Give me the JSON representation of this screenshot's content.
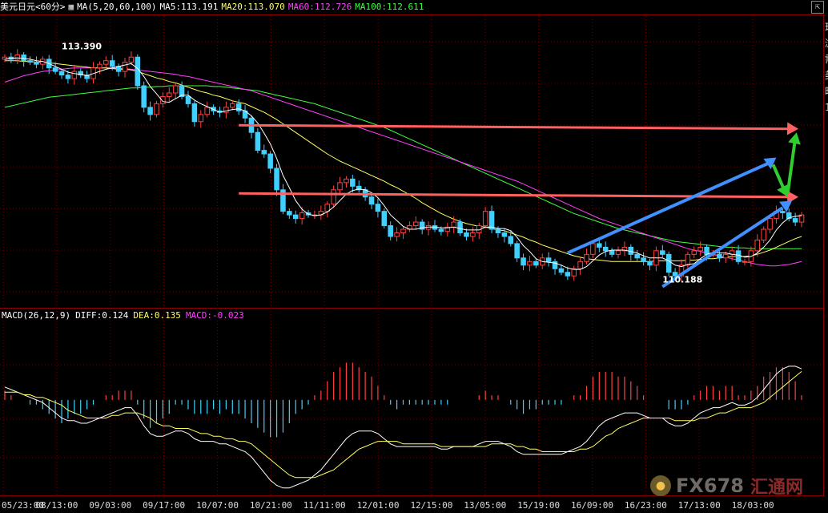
{
  "header": {
    "symbol": "美元日元<60分>",
    "ma_label": "MA(5,20,60,100)",
    "ma5": "MA5:113.191",
    "ma20": "MA20:113.070",
    "ma60": "MA60:112.726",
    "ma100": "MA100:112.611"
  },
  "macd_header": {
    "label": "MACD(26,12,9)",
    "diff": "DIFF:0.124",
    "dea": "DEA:0.135",
    "macd": "MACD:-0.023"
  },
  "window_button": "⇱",
  "right_column": [
    "现",
    "浏",
    "需",
    "美",
    "昨",
    "1"
  ],
  "watermark": {
    "text": "FX678",
    "cn": "汇通网"
  },
  "colors": {
    "up": "#ff4040",
    "down": "#40d0ff",
    "ma5": "#ffffff",
    "ma20": "#ffff60",
    "ma60": "#ff40ff",
    "ma100": "#40ff40",
    "diff": "#ffffff",
    "dea": "#ffff60",
    "hline": "#ff6060",
    "channel": "#4090ff",
    "arrow": "#30cc30"
  },
  "chart_data": {
    "type": "candlestick",
    "x_ticks": [
      "05/23:00",
      "08/13:00",
      "09/03:00",
      "09/17:00",
      "10/07:00",
      "10/21:00",
      "11/11:00",
      "12/01:00",
      "12/15:00",
      "13/05:00",
      "15/19:00",
      "16/09:00",
      "16/23:00",
      "17/13:00",
      "18/03:00"
    ],
    "price_range": [
      109.8,
      113.8
    ],
    "annotations": [
      "113.390",
      "110.188"
    ],
    "close": [
      113.25,
      113.22,
      113.28,
      113.2,
      113.18,
      113.15,
      113.22,
      113.1,
      113.05,
      113.0,
      112.95,
      113.05,
      113.0,
      112.95,
      113.1,
      113.15,
      113.2,
      113.12,
      113.05,
      113.18,
      113.25,
      112.85,
      112.55,
      112.45,
      112.6,
      112.7,
      112.75,
      112.85,
      112.7,
      112.6,
      112.35,
      112.45,
      112.55,
      112.5,
      112.48,
      112.55,
      112.6,
      112.5,
      112.4,
      112.2,
      111.95,
      111.9,
      111.7,
      111.4,
      111.1,
      111.05,
      111.0,
      111.08,
      111.05,
      111.05,
      111.1,
      111.2,
      111.4,
      111.5,
      111.55,
      111.45,
      111.4,
      111.3,
      111.2,
      111.1,
      110.9,
      110.75,
      110.8,
      110.85,
      110.9,
      110.95,
      110.85,
      110.9,
      110.85,
      110.82,
      110.88,
      110.95,
      110.8,
      110.75,
      110.8,
      110.9,
      111.1,
      110.85,
      110.8,
      110.75,
      110.65,
      110.45,
      110.35,
      110.4,
      110.35,
      110.45,
      110.4,
      110.3,
      110.25,
      110.2,
      110.3,
      110.4,
      110.5,
      110.65,
      110.6,
      110.55,
      110.5,
      110.55,
      110.6,
      110.5,
      110.45,
      110.4,
      110.35,
      110.55,
      110.5,
      110.25,
      110.2,
      110.35,
      110.5,
      110.55,
      110.6,
      110.5,
      110.5,
      110.45,
      110.5,
      110.55,
      110.4,
      110.4,
      110.55,
      110.7,
      110.85,
      111.0,
      111.1,
      111.08,
      111.0,
      110.95,
      111.05
    ],
    "ma5": [
      113.22,
      113.23,
      113.24,
      113.23,
      113.22,
      113.2,
      113.19,
      113.16,
      113.12,
      113.08,
      113.04,
      113.02,
      113.01,
      112.99,
      113.02,
      113.05,
      113.08,
      113.1,
      113.12,
      113.14,
      113.16,
      113.09,
      112.98,
      112.84,
      112.74,
      112.63,
      112.62,
      112.67,
      112.72,
      112.72,
      112.65,
      112.6,
      112.56,
      112.52,
      112.48,
      112.5,
      112.52,
      112.53,
      112.5,
      112.43,
      112.33,
      112.19,
      112.04,
      111.84,
      111.6,
      111.43,
      111.25,
      111.13,
      111.06,
      111.04,
      111.05,
      111.09,
      111.16,
      111.25,
      111.34,
      111.39,
      111.41,
      111.4,
      111.36,
      111.29,
      111.18,
      111.05,
      110.97,
      110.89,
      110.85,
      110.85,
      110.87,
      110.88,
      110.88,
      110.87,
      110.87,
      110.88,
      110.86,
      110.84,
      110.84,
      110.84,
      110.88,
      110.88,
      110.86,
      110.86,
      110.83,
      110.74,
      110.62,
      110.54,
      110.44,
      110.4,
      110.39,
      110.38,
      110.35,
      110.31,
      110.29,
      110.29,
      110.33,
      110.41,
      110.49,
      110.54,
      110.56,
      110.56,
      110.56,
      110.54,
      110.52,
      110.48,
      110.45,
      110.45,
      110.45,
      110.41,
      110.35,
      110.33,
      110.36,
      110.37,
      110.44,
      110.5,
      110.53,
      110.52,
      110.52,
      110.5,
      110.49,
      110.46,
      110.47,
      110.52,
      110.6,
      110.7,
      110.84,
      110.94,
      111.01,
      111.03,
      111.04
    ],
    "ma20": [
      113.2,
      113.2,
      113.2,
      113.19,
      113.19,
      113.18,
      113.18,
      113.17,
      113.16,
      113.15,
      113.14,
      113.13,
      113.12,
      113.11,
      113.1,
      113.1,
      113.1,
      113.09,
      113.08,
      113.08,
      113.07,
      113.05,
      113.02,
      112.99,
      112.96,
      112.94,
      112.91,
      112.89,
      112.86,
      112.83,
      112.8,
      112.77,
      112.75,
      112.72,
      112.7,
      112.67,
      112.64,
      112.62,
      112.6,
      112.56,
      112.52,
      112.48,
      112.43,
      112.38,
      112.32,
      112.26,
      112.2,
      112.14,
      112.08,
      112.02,
      111.96,
      111.9,
      111.85,
      111.8,
      111.76,
      111.72,
      111.68,
      111.64,
      111.6,
      111.56,
      111.52,
      111.47,
      111.43,
      111.38,
      111.33,
      111.28,
      111.22,
      111.17,
      111.12,
      111.07,
      111.03,
      110.99,
      110.96,
      110.93,
      110.91,
      110.89,
      110.88,
      110.86,
      110.84,
      110.83,
      110.8,
      110.77,
      110.74,
      110.7,
      110.67,
      110.63,
      110.6,
      110.57,
      110.54,
      110.51,
      110.48,
      110.46,
      110.44,
      110.43,
      110.42,
      110.41,
      110.4,
      110.4,
      110.4,
      110.4,
      110.4,
      110.4,
      110.4,
      110.41,
      110.41,
      110.41,
      110.41,
      110.41,
      110.42,
      110.42,
      110.43,
      110.44,
      110.44,
      110.45,
      110.46,
      110.47,
      110.47,
      110.47,
      110.48,
      110.5,
      110.53,
      110.56,
      110.6,
      110.64,
      110.68,
      110.72,
      110.75
    ],
    "ma60": [
      112.9,
      112.93,
      112.96,
      112.99,
      113.01,
      113.03,
      113.05,
      113.06,
      113.07,
      113.08,
      113.09,
      113.1,
      113.1,
      113.1,
      113.1,
      113.1,
      113.1,
      113.1,
      113.09,
      113.09,
      113.08,
      113.07,
      113.06,
      113.05,
      113.04,
      113.03,
      113.02,
      113.01,
      112.99,
      112.98,
      112.96,
      112.94,
      112.92,
      112.9,
      112.88,
      112.86,
      112.84,
      112.82,
      112.8,
      112.78,
      112.75,
      112.72,
      112.69,
      112.66,
      112.63,
      112.6,
      112.57,
      112.54,
      112.51,
      112.48,
      112.45,
      112.42,
      112.39,
      112.36,
      112.33,
      112.3,
      112.27,
      112.24,
      112.21,
      112.18,
      112.15,
      112.12,
      112.09,
      112.06,
      112.03,
      112.0,
      111.97,
      111.94,
      111.91,
      111.88,
      111.85,
      111.82,
      111.79,
      111.76,
      111.73,
      111.7,
      111.67,
      111.64,
      111.61,
      111.58,
      111.55,
      111.52,
      111.48,
      111.44,
      111.4,
      111.36,
      111.32,
      111.28,
      111.24,
      111.2,
      111.16,
      111.12,
      111.08,
      111.04,
      111.0,
      110.97,
      110.94,
      110.91,
      110.88,
      110.85,
      110.82,
      110.79,
      110.76,
      110.73,
      110.7,
      110.67,
      110.64,
      110.61,
      110.58,
      110.56,
      110.54,
      110.52,
      110.5,
      110.48,
      110.46,
      110.44,
      110.42,
      110.4,
      110.38,
      110.36,
      110.35,
      110.34,
      110.34,
      110.35,
      110.36,
      110.38,
      110.4
    ],
    "ma100": [
      112.55,
      112.57,
      112.59,
      112.61,
      112.63,
      112.65,
      112.67,
      112.69,
      112.7,
      112.71,
      112.72,
      112.73,
      112.74,
      112.75,
      112.76,
      112.77,
      112.78,
      112.79,
      112.8,
      112.81,
      112.82,
      112.82,
      112.83,
      112.83,
      112.84,
      112.84,
      112.85,
      112.85,
      112.85,
      112.85,
      112.85,
      112.85,
      112.85,
      112.84,
      112.84,
      112.83,
      112.82,
      112.81,
      112.8,
      112.79,
      112.78,
      112.76,
      112.74,
      112.72,
      112.7,
      112.68,
      112.66,
      112.64,
      112.62,
      112.6,
      112.57,
      112.54,
      112.51,
      112.48,
      112.45,
      112.42,
      112.39,
      112.36,
      112.33,
      112.3,
      112.27,
      112.23,
      112.19,
      112.15,
      112.11,
      112.07,
      112.03,
      111.99,
      111.95,
      111.91,
      111.87,
      111.83,
      111.79,
      111.75,
      111.71,
      111.67,
      111.63,
      111.59,
      111.55,
      111.51,
      111.47,
      111.43,
      111.39,
      111.35,
      111.31,
      111.27,
      111.23,
      111.19,
      111.15,
      111.11,
      111.07,
      111.04,
      111.01,
      110.98,
      110.95,
      110.92,
      110.89,
      110.86,
      110.84,
      110.82,
      110.8,
      110.78,
      110.76,
      110.74,
      110.72,
      110.7,
      110.68,
      110.67,
      110.66,
      110.65,
      110.64,
      110.63,
      110.62,
      110.61,
      110.6,
      110.6,
      110.59,
      110.59,
      110.58,
      110.58,
      110.58,
      110.58,
      110.58,
      110.58,
      110.58,
      110.58,
      110.58
    ],
    "macd_range": [
      -0.35,
      0.3
    ],
    "diff": [
      0.05,
      0.04,
      0.03,
      0.02,
      0.01,
      0.0,
      -0.01,
      -0.03,
      -0.05,
      -0.07,
      -0.08,
      -0.08,
      -0.09,
      -0.09,
      -0.08,
      -0.07,
      -0.06,
      -0.05,
      -0.04,
      -0.03,
      -0.03,
      -0.06,
      -0.1,
      -0.13,
      -0.14,
      -0.14,
      -0.13,
      -0.12,
      -0.12,
      -0.13,
      -0.15,
      -0.16,
      -0.16,
      -0.16,
      -0.17,
      -0.17,
      -0.18,
      -0.19,
      -0.2,
      -0.22,
      -0.25,
      -0.28,
      -0.31,
      -0.33,
      -0.34,
      -0.34,
      -0.33,
      -0.32,
      -0.31,
      -0.29,
      -0.27,
      -0.24,
      -0.21,
      -0.18,
      -0.15,
      -0.13,
      -0.12,
      -0.12,
      -0.12,
      -0.13,
      -0.15,
      -0.17,
      -0.18,
      -0.18,
      -0.18,
      -0.18,
      -0.18,
      -0.18,
      -0.18,
      -0.19,
      -0.19,
      -0.18,
      -0.18,
      -0.18,
      -0.18,
      -0.17,
      -0.16,
      -0.16,
      -0.16,
      -0.17,
      -0.18,
      -0.2,
      -0.21,
      -0.21,
      -0.21,
      -0.21,
      -0.21,
      -0.21,
      -0.21,
      -0.2,
      -0.19,
      -0.18,
      -0.16,
      -0.13,
      -0.1,
      -0.08,
      -0.07,
      -0.06,
      -0.05,
      -0.05,
      -0.05,
      -0.06,
      -0.07,
      -0.07,
      -0.07,
      -0.09,
      -0.1,
      -0.1,
      -0.09,
      -0.07,
      -0.05,
      -0.04,
      -0.03,
      -0.03,
      -0.02,
      -0.01,
      -0.02,
      -0.02,
      -0.01,
      0.01,
      0.04,
      0.07,
      0.1,
      0.12,
      0.13,
      0.13,
      0.12
    ],
    "dea": [
      0.03,
      0.03,
      0.03,
      0.02,
      0.02,
      0.01,
      0.01,
      0.0,
      -0.01,
      -0.02,
      -0.04,
      -0.05,
      -0.06,
      -0.07,
      -0.07,
      -0.07,
      -0.07,
      -0.06,
      -0.06,
      -0.05,
      -0.05,
      -0.05,
      -0.06,
      -0.07,
      -0.09,
      -0.1,
      -0.1,
      -0.11,
      -0.11,
      -0.11,
      -0.12,
      -0.13,
      -0.13,
      -0.14,
      -0.14,
      -0.15,
      -0.15,
      -0.16,
      -0.16,
      -0.17,
      -0.19,
      -0.21,
      -0.23,
      -0.25,
      -0.27,
      -0.29,
      -0.3,
      -0.3,
      -0.3,
      -0.3,
      -0.29,
      -0.28,
      -0.27,
      -0.25,
      -0.23,
      -0.21,
      -0.19,
      -0.18,
      -0.17,
      -0.16,
      -0.16,
      -0.16,
      -0.16,
      -0.17,
      -0.17,
      -0.17,
      -0.17,
      -0.17,
      -0.17,
      -0.18,
      -0.18,
      -0.18,
      -0.18,
      -0.18,
      -0.18,
      -0.18,
      -0.18,
      -0.17,
      -0.17,
      -0.17,
      -0.17,
      -0.18,
      -0.18,
      -0.19,
      -0.19,
      -0.2,
      -0.2,
      -0.2,
      -0.2,
      -0.2,
      -0.2,
      -0.19,
      -0.19,
      -0.18,
      -0.16,
      -0.14,
      -0.13,
      -0.11,
      -0.1,
      -0.09,
      -0.08,
      -0.07,
      -0.07,
      -0.07,
      -0.07,
      -0.07,
      -0.08,
      -0.08,
      -0.08,
      -0.08,
      -0.07,
      -0.07,
      -0.06,
      -0.05,
      -0.05,
      -0.04,
      -0.03,
      -0.03,
      -0.03,
      -0.02,
      -0.01,
      0.01,
      0.03,
      0.05,
      0.07,
      0.09,
      0.11
    ]
  }
}
